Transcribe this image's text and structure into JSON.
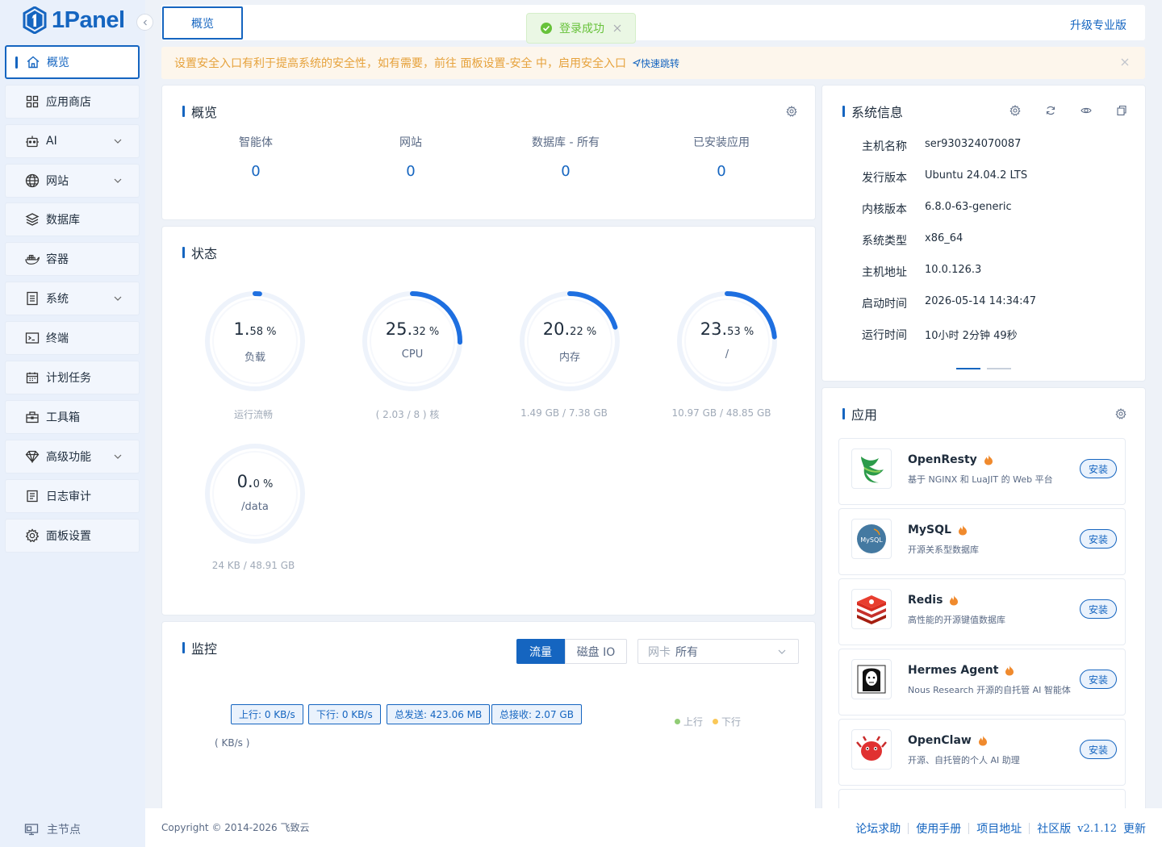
{
  "brand": {
    "name": "1Panel"
  },
  "sidebar": {
    "items": [
      {
        "label": "概览",
        "icon": "home-icon"
      },
      {
        "label": "应用商店",
        "icon": "grid-icon"
      },
      {
        "label": "AI",
        "icon": "robot-icon"
      },
      {
        "label": "网站",
        "icon": "globe-icon"
      },
      {
        "label": "数据库",
        "icon": "layers-icon"
      },
      {
        "label": "容器",
        "icon": "docker-icon"
      },
      {
        "label": "系统",
        "icon": "file-icon"
      },
      {
        "label": "终端",
        "icon": "terminal-icon"
      },
      {
        "label": "计划任务",
        "icon": "calendar-icon"
      },
      {
        "label": "工具箱",
        "icon": "toolbox-icon"
      },
      {
        "label": "高级功能",
        "icon": "diamond-icon"
      },
      {
        "label": "日志审计",
        "icon": "log-icon"
      },
      {
        "label": "面板设置",
        "icon": "gear-icon"
      }
    ],
    "node_label": "主节点"
  },
  "topbar": {
    "tab_label": "概览",
    "upgrade_label": "升级专业版"
  },
  "toast": {
    "message": "登录成功"
  },
  "notice": {
    "text": "设置安全入口有利于提高系统的安全性，如有需要，前往 面板设置-安全 中，启用安全入口",
    "link": "快速跳转"
  },
  "overview": {
    "title": "概览",
    "stats": [
      {
        "label": "智能体",
        "value": "0"
      },
      {
        "label": "网站",
        "value": "0"
      },
      {
        "label": "数据库 - 所有",
        "value": "0"
      },
      {
        "label": "已安装应用",
        "value": "0"
      }
    ]
  },
  "status": {
    "title": "状态",
    "gauges": [
      {
        "int": "1.",
        "dec": "58",
        "unit": " %",
        "label": "负载",
        "footer": "运行流畅",
        "percent": 1.58
      },
      {
        "int": "25.",
        "dec": "32",
        "unit": " %",
        "label": "CPU",
        "footer": "( 2.03 / 8 ) 核",
        "percent": 25.32
      },
      {
        "int": "20.",
        "dec": "22",
        "unit": " %",
        "label": "内存",
        "footer": "1.49 GB / 7.38 GB",
        "percent": 20.22
      },
      {
        "int": "23.",
        "dec": "53",
        "unit": " %",
        "label": "/",
        "footer": "10.97 GB / 48.85 GB",
        "percent": 23.53
      },
      {
        "int": "0.",
        "dec": "0",
        "unit": " %",
        "label": "/data",
        "footer": "24 KB / 48.91 GB",
        "percent": 0
      }
    ]
  },
  "monitor": {
    "title": "监控",
    "btn_flow": "流量",
    "btn_disk": "磁盘 IO",
    "nic_prefix": "网卡",
    "nic_value": "所有",
    "tags": [
      "上行: 0 KB/s",
      "下行: 0 KB/s",
      "总发送: 423.06 MB",
      "总接收: 2.07 GB"
    ],
    "legend": [
      {
        "name": "上行",
        "color": "#91cc75"
      },
      {
        "name": "下行",
        "color": "#fac858"
      }
    ],
    "unit": "( KB/s )"
  },
  "sysinfo": {
    "title": "系统信息",
    "rows": [
      {
        "k": "主机名称",
        "v": "ser930324070087"
      },
      {
        "k": "发行版本",
        "v": "Ubuntu 24.04.2 LTS"
      },
      {
        "k": "内核版本",
        "v": "6.8.0-63-generic"
      },
      {
        "k": "系统类型",
        "v": "x86_64"
      },
      {
        "k": "主机地址",
        "v": "10.0.126.3"
      },
      {
        "k": "启动时间",
        "v": "2026-05-14 14:34:47"
      },
      {
        "k": "运行时间",
        "v": "10小时 2分钟 49秒"
      }
    ]
  },
  "apps": {
    "title": "应用",
    "install_label": "安装",
    "items": [
      {
        "name": "OpenResty",
        "desc": "基于 NGINX 和 LuaJIT 的 Web 平台"
      },
      {
        "name": "MySQL",
        "desc": "开源关系型数据库"
      },
      {
        "name": "Redis",
        "desc": "高性能的开源键值数据库"
      },
      {
        "name": "Hermes Agent",
        "desc": "Nous Research 开源的自托管 AI 智能体"
      },
      {
        "name": "OpenClaw",
        "desc": "开源、自托管的个人 AI 助理"
      }
    ]
  },
  "footer": {
    "copyright": "Copyright © 2014-2026 飞致云",
    "links": [
      "论坛求助",
      "使用手册",
      "项目地址",
      "社区版"
    ],
    "version": "v2.1.12",
    "update": "更新"
  },
  "colors": {
    "accent": "#1565c0",
    "success": "#67c23a",
    "warning": "#e6a23c"
  }
}
